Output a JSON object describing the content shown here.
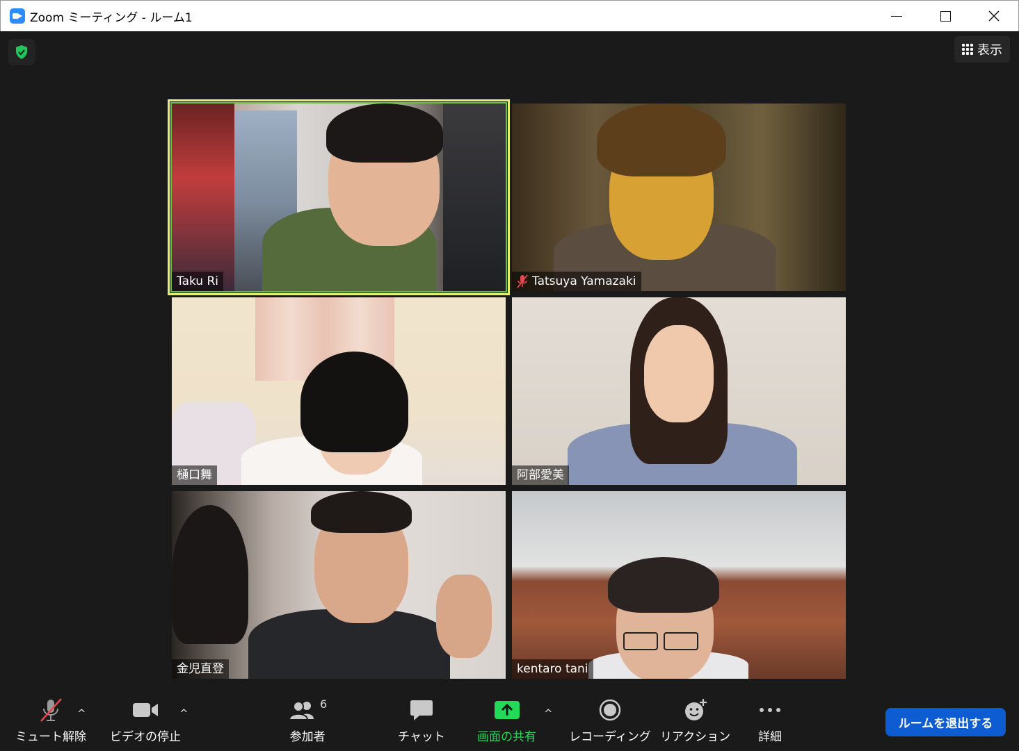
{
  "window": {
    "title": "Zoom ミーティング - ルーム1"
  },
  "top": {
    "view_label": "表示"
  },
  "participants": [
    {
      "name": "Taku Ri",
      "muted": false
    },
    {
      "name": "Tatsuya Yamazaki",
      "muted": true
    },
    {
      "name": "樋口舞",
      "muted": false
    },
    {
      "name": "阿部愛美",
      "muted": false
    },
    {
      "name": "金児直登",
      "muted": false
    },
    {
      "name": "kentaro tani",
      "muted": false
    }
  ],
  "toolbar": {
    "unmute": "ミュート解除",
    "stop_video": "ビデオの停止",
    "participants": "参加者",
    "participants_count": "6",
    "chat": "チャット",
    "share": "画面の共有",
    "record": "レコーディング",
    "reactions": "リアクション",
    "more": "詳細",
    "leave": "ルームを退出する"
  },
  "colors": {
    "accent_blue": "#0e5cd1",
    "share_green": "#23d959",
    "active_speaker": "#e4ef73",
    "shield_green": "#22c55e"
  }
}
